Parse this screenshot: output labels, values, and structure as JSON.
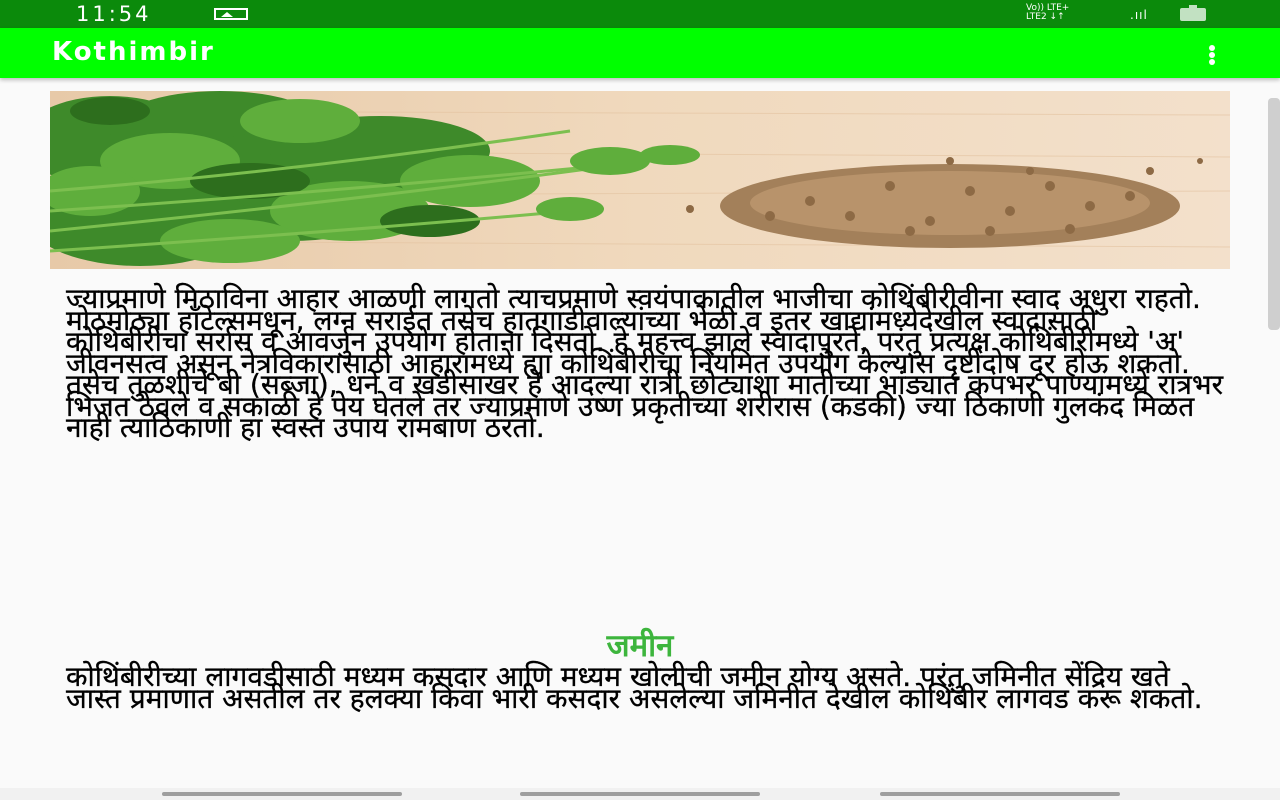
{
  "status_bar": {
    "time": "11:54",
    "network_line1": "Vo)) LTE+",
    "network_line2": "LTE2 ↓↑",
    "signal": ".ııl",
    "icons": [
      "gallery-icon",
      "signal-icon",
      "battery-icon"
    ]
  },
  "app_bar": {
    "title": "Kothimbir",
    "menu_icon": "more-vert-icon"
  },
  "colors": {
    "status_bar": "#0b8a0b",
    "app_bar": "#00ff00",
    "heading": "#3db53d",
    "background": "#fafafa"
  },
  "article": {
    "paragraph_1": "ज्याप्रमाणे मिठाविना आहार आळणी लागतो त्याचप्रमाणे स्वयंपाकातील भाजीचा कोथिंबीरीवीना स्वाद अधुरा राहतो. मोठमोठ्या हॉटेल्समधून, लग्न सराईत तसेच हातगाडीवाल्यांच्या भेळी व इतर खाद्यांमध्येदेखील स्वादासाठी कोथिंबीरीचा सर्रास व आवर्जुन उपयोग होताना दिसतो. हे महत्त्व झाले स्वादापुरते, परंतु प्रत्यक्ष कोथिंबीरीमध्ये 'अ' जीवनसत्व असून नेत्रविकारासाठी आहारामध्ये ह्या कोथिंबीरीचा नियमित उपयोग केल्यास दृष्टीदोष दूर होऊ शकतो. तसेच तुळशीचे बी (सब्जा), धने व खडीसाखर हे आदल्या रात्री छोट्याशा मातीच्या भांड्यात कपभर पाण्यामध्ये रात्रभर भिजत ठेवले व सकाळी हे पेय घेतले तर ज्याप्रमाणे उष्ण प्रकृतीच्या शरीरास (कडकी) ज्या ठिकाणी गुलकंद मिळत नाही त्याठिकाणी हा स्वस्त उपाय रामबाण ठरतो.",
    "section_heading": "जमीन",
    "paragraph_2": "कोथिंबीरीच्या लागवडीसाठी मध्यम कसदार आणि मध्यम खोलीची जमीन योग्य असते. परंतु जमिनीत सेंद्रिय खते जास्त प्रमाणात असतील तर हलक्या किंवा भारी कसदार असलेल्या जमिनीत देखील कोथिंबीर लागवड करू शकतो."
  }
}
